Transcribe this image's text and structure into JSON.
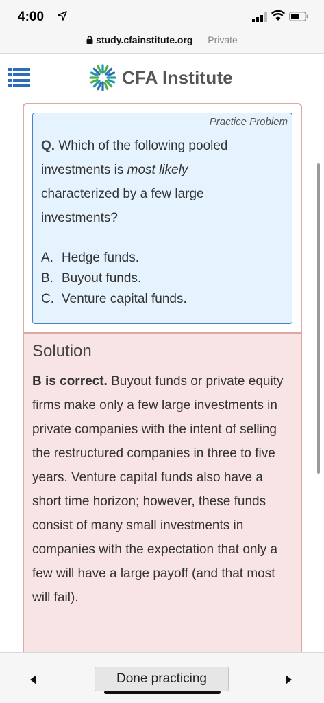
{
  "status": {
    "time": "4:00"
  },
  "browser": {
    "domain": "study.cfainstitute.org",
    "private_label": "— Private"
  },
  "header": {
    "logo_text": "CFA Institute"
  },
  "problem": {
    "tag": "Practice Problem",
    "q_prefix": "Q.",
    "q_text_before": "Which of the following pooled investments is",
    "q_emphasis": "most likely",
    "q_text_after": "characterized by a few large investments?",
    "options": [
      {
        "letter": "A.",
        "text": "Hedge funds."
      },
      {
        "letter": "B.",
        "text": "Buyout funds."
      },
      {
        "letter": "C.",
        "text": "Venture capital funds."
      }
    ]
  },
  "solution": {
    "title": "Solution",
    "lead": "B is correct.",
    "body": "Buyout funds or private equity firms make only a few large investments in private companies with the intent of selling the restructured companies in three to five years. Venture capital funds also have a short time horizon; however, these funds consist of many small investments in companies with the expectation that only a few will have a large payoff (and that most will fail)."
  },
  "toolbar": {
    "done_label": "Done practicing"
  },
  "colors": {
    "accent_blue": "#2a6db8",
    "card_border": "#e0a7a7",
    "card_bg": "#f8e4e4",
    "problem_bg": "#e4f3fd"
  }
}
